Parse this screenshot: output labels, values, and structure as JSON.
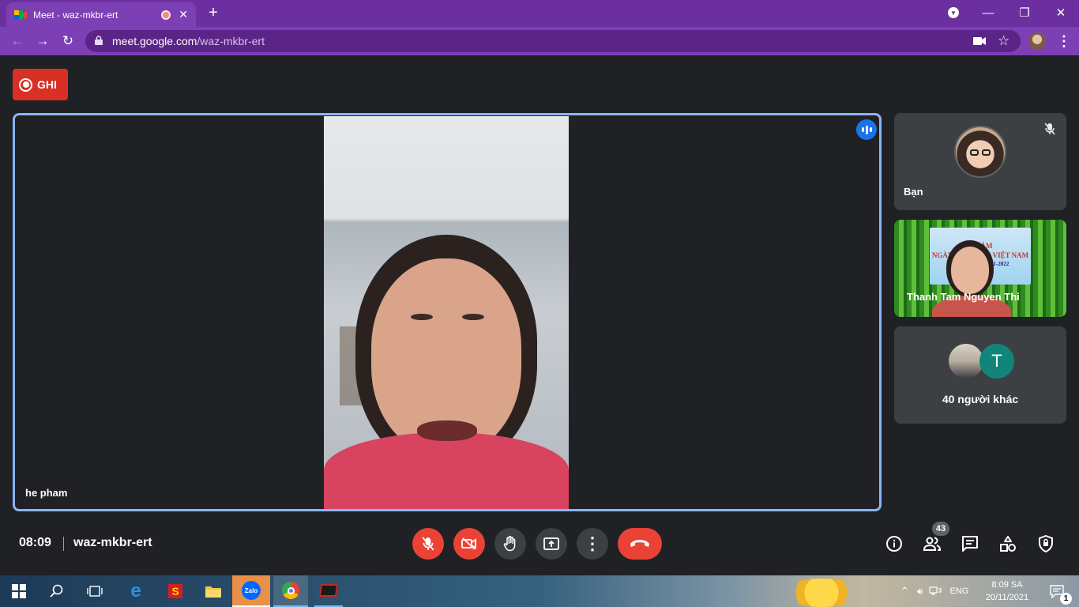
{
  "browser": {
    "tab_title": "Meet - waz-mkbr-ert",
    "url_host": "meet.google.com",
    "url_path": "/waz-mkbr-ert",
    "colors": {
      "frame": "#6b2fa0",
      "toolbar": "#7d3fb4"
    }
  },
  "meet": {
    "record_label": "GHI",
    "main_participant": "he pham",
    "participants": [
      {
        "name": "Bạn",
        "muted": true
      },
      {
        "name": "Thanh Tam Nguyen Thi"
      },
      {
        "name": "40 người khác",
        "avatar_letter": "T"
      }
    ],
    "background_banner": {
      "line1": "ĐÀM",
      "line2": "NGÀY NHÀ GIÁO VIỆT NAM",
      "line3": "2021-2022"
    },
    "time": "08:09",
    "meeting_code": "waz-mkbr-ert",
    "participant_count": "43",
    "accent_color": "#1a73e8",
    "danger_color": "#ea4335"
  },
  "taskbar": {
    "lang": "ENG",
    "time": "8:09 SA",
    "date": "20/11/2021",
    "notification_count": "1",
    "zalo_label": "Zalo"
  }
}
